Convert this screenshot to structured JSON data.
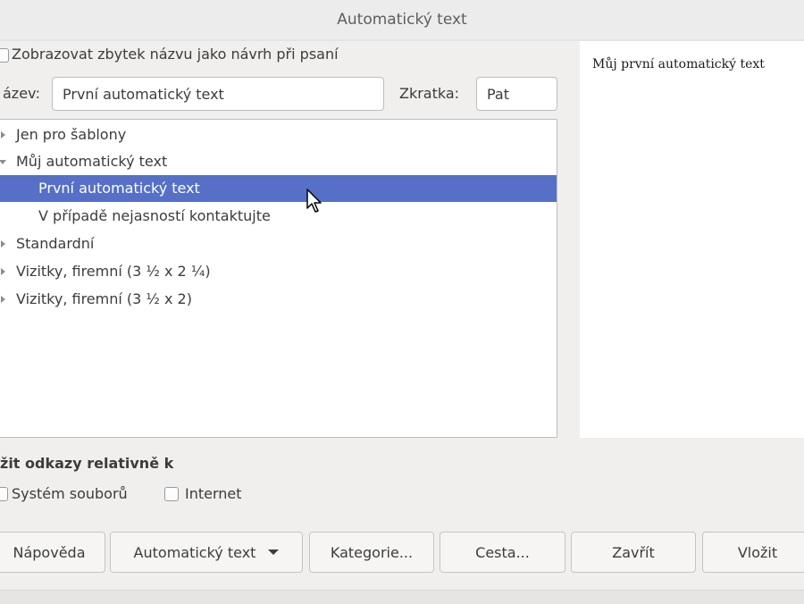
{
  "window": {
    "title": "Automatický text"
  },
  "options": {
    "show_suggestion_label": "Zobrazovat zbytek názvu jako návrh při psaní"
  },
  "fields": {
    "name_label": "ázev:",
    "name_value": "První automatický text",
    "shortcut_label": "Zkratka:",
    "shortcut_value": "Pat"
  },
  "tree": {
    "items": [
      {
        "label": "Jen pro šablony",
        "level": 0,
        "expander": "collapsed",
        "selected": false
      },
      {
        "label": "Můj automatický text",
        "level": 0,
        "expander": "expanded",
        "selected": false
      },
      {
        "label": "První automatický text",
        "level": 1,
        "expander": "none",
        "selected": true
      },
      {
        "label": "V případě nejasností kontaktujte",
        "level": 1,
        "expander": "none",
        "selected": false
      },
      {
        "label": "Standardní",
        "level": 0,
        "expander": "collapsed",
        "selected": false
      },
      {
        "label": "Vizitky, firemní (3 ½ x 2 ¼)",
        "level": 0,
        "expander": "collapsed",
        "selected": false
      },
      {
        "label": "Vizitky, firemní (3 ½ x 2)",
        "level": 0,
        "expander": "collapsed",
        "selected": false
      }
    ]
  },
  "preview": {
    "text": "Můj první automatický text"
  },
  "relative_links": {
    "heading": "žit odkazy relativně k",
    "file_system_label": "Systém souborů",
    "internet_label": "Internet"
  },
  "buttons": {
    "help": "Nápověda",
    "autotext": "Automatický text",
    "categories": "Kategorie...",
    "path": "Cesta...",
    "close": "Zavřít",
    "insert": "Vložit"
  },
  "colors": {
    "selection": "#5670c8",
    "selection_text": "#ffffff"
  }
}
